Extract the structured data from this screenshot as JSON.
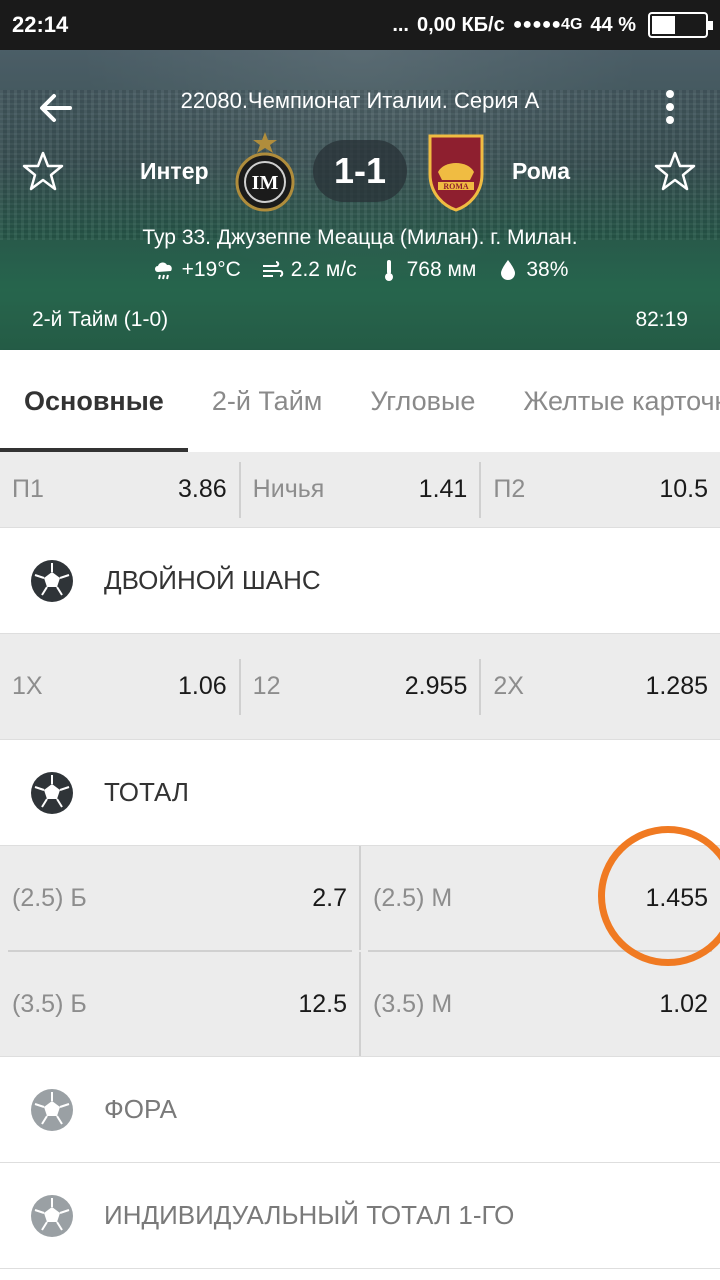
{
  "status_bar": {
    "time": "22:14",
    "dots": "...",
    "network_speed": "0,00 КБ/с",
    "signal": "●●●●●4G",
    "battery_percent": "44 %",
    "battery_level": 0.44
  },
  "match": {
    "league": "22080.Чемпионат Италии. Серия А",
    "home_team": "Интер",
    "away_team": "Рома",
    "score": "1-1",
    "venue": "Тур 33. Джузеппе Меацца (Милан). г. Милан.",
    "weather": {
      "temperature": "+19°C",
      "wind": "2.2 м/с",
      "pressure": "768 мм",
      "humidity": "38%"
    },
    "half": "2-й  Тайм (1-0)",
    "clock": "82:19"
  },
  "tabs": [
    "Основные",
    "2-й  Тайм",
    "Угловые",
    "Желтые карточки"
  ],
  "main_odds": [
    {
      "label": "П1",
      "value": "3.86"
    },
    {
      "label": "Ничья",
      "value": "1.41"
    },
    {
      "label": "П2",
      "value": "10.5"
    }
  ],
  "double_chance": {
    "title": "ДВОЙНОЙ ШАНС",
    "odds": [
      {
        "label": "1X",
        "value": "1.06"
      },
      {
        "label": "12",
        "value": "2.955"
      },
      {
        "label": "2X",
        "value": "1.285"
      }
    ]
  },
  "total": {
    "title": "ТОТАЛ",
    "rows": [
      [
        {
          "label": "(2.5) Б",
          "value": "2.7"
        },
        {
          "label": "(2.5) М",
          "value": "1.455"
        }
      ],
      [
        {
          "label": "(3.5) Б",
          "value": "12.5"
        },
        {
          "label": "(3.5) М",
          "value": "1.02"
        }
      ]
    ]
  },
  "collapsed_sections": [
    "ФОРА",
    "ИНДИВИДУАЛЬНЫЙ ТОТАЛ 1-ГО"
  ],
  "colors": {
    "accent_ring": "#f07a22",
    "status_bar": "#1a1a1a",
    "odds_row_bg": "#ececec"
  },
  "icons": {
    "back": "arrow-left-icon",
    "menu": "more-vert-icon",
    "favorite": "star-outline-icon",
    "section": "soccer-ball-icon"
  }
}
